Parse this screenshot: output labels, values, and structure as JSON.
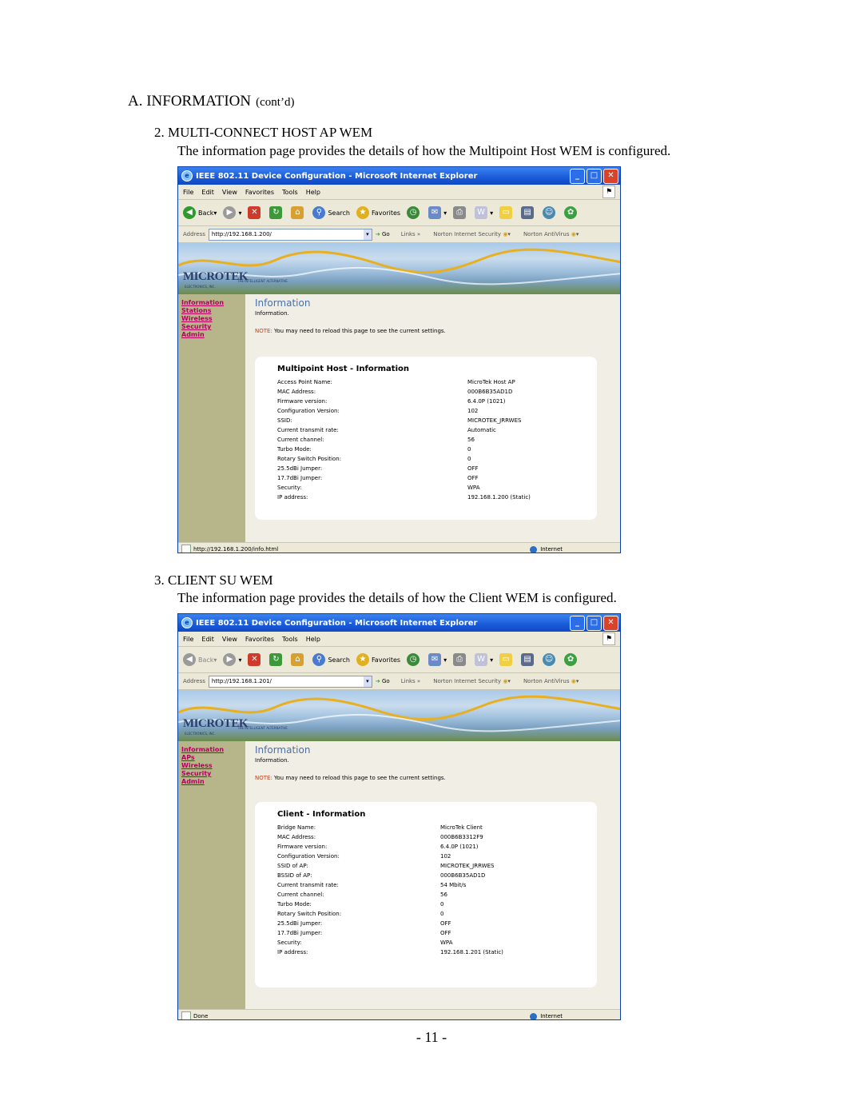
{
  "heading": {
    "main": "A. INFORMATION",
    "contd": "(cont’d)"
  },
  "sections": [
    {
      "title": "2.  MULTI-CONNECT HOST AP WEM",
      "description": "The information page provides the details of how the Multipoint Host WEM is configured.",
      "browser": {
        "window_title": "IEEE 802.11 Device Configuration - Microsoft Internet Explorer",
        "menu": [
          "File",
          "Edit",
          "View",
          "Favorites",
          "Tools",
          "Help"
        ],
        "toolbar": {
          "back": "Back",
          "search": "Search",
          "favorites": "Favorites"
        },
        "address_label": "Address",
        "address": "http://192.168.1.200/",
        "go": "Go",
        "links": "Links",
        "norton_security": "Norton Internet Security",
        "norton_antivirus": "Norton AntiVirus",
        "logo": "MICROTEK",
        "logo_sub": "ELECTRONICS, INC.",
        "logo_tag": "THE INTELLIGENT ALTERNATIVE",
        "nav": [
          "Information",
          "Stations",
          "Wireless",
          "Security",
          "Admin"
        ],
        "page_title": "Information",
        "page_subtitle": "Information.",
        "note_label": "NOTE:",
        "note_text": "You may need to reload this page to see the current settings.",
        "card_title": "Multipoint Host - Information",
        "rows": [
          {
            "label": "Access Point Name:",
            "value": "MicroTek Host AP"
          },
          {
            "label": "MAC Address:",
            "value": "000B6B35AD1D"
          },
          {
            "label": "Firmware version:",
            "value": "6.4.0P (1021)"
          },
          {
            "label": "Configuration Version:",
            "value": "102"
          },
          {
            "label": "SSID:",
            "value": "MICROTEK_JRRWES"
          },
          {
            "label": "Current transmit rate:",
            "value": "Automatic"
          },
          {
            "label": "Current channel:",
            "value": "56"
          },
          {
            "label": "Turbo Mode:",
            "value": "0"
          },
          {
            "label": "Rotary Switch Position:",
            "value": "0"
          },
          {
            "label": "25.5dBi Jumper:",
            "value": "OFF"
          },
          {
            "label": "17.7dBi Jumper:",
            "value": "OFF"
          },
          {
            "label": "Security:",
            "value": "WPA"
          },
          {
            "label": "IP address:",
            "value": "192.168.1.200 (Static)"
          }
        ],
        "status_text": "http://192.168.1.200/info.html",
        "status_zone": "Internet"
      }
    },
    {
      "title": "3.  CLIENT SU WEM",
      "description": "The information page provides the details of how the Client WEM is configured.",
      "browser": {
        "window_title": "IEEE 802.11 Device Configuration - Microsoft Internet Explorer",
        "menu": [
          "File",
          "Edit",
          "View",
          "Favorites",
          "Tools",
          "Help"
        ],
        "toolbar": {
          "back": "Back",
          "search": "Search",
          "favorites": "Favorites"
        },
        "address_label": "Address",
        "address": "http://192.168.1.201/",
        "go": "Go",
        "links": "Links",
        "norton_security": "Norton Internet Security",
        "norton_antivirus": "Norton AntiVirus",
        "logo": "MICROTEK",
        "logo_sub": "ELECTRONICS, INC.",
        "logo_tag": "THE INTELLIGENT ALTERNATIVE",
        "nav": [
          "Information",
          "APs",
          "Wireless",
          "Security",
          "Admin"
        ],
        "page_title": "Information",
        "page_subtitle": "Information.",
        "note_label": "NOTE:",
        "note_text": "You may need to reload this page to see the current settings.",
        "card_title": "Client - Information",
        "rows": [
          {
            "label": "Bridge Name:",
            "value": "MicroTek Client"
          },
          {
            "label": "MAC Address:",
            "value": "000B6B3312F9"
          },
          {
            "label": "Firmware version:",
            "value": "6.4.0P (1021)"
          },
          {
            "label": "Configuration Version:",
            "value": "102"
          },
          {
            "label": "SSID of AP:",
            "value": "MICROTEK_JRRWES"
          },
          {
            "label": "BSSID of AP:",
            "value": "000B6B35AD1D"
          },
          {
            "label": "Current transmit rate:",
            "value": "54 Mbit/s"
          },
          {
            "label": "Current channel:",
            "value": "56"
          },
          {
            "label": "Turbo Mode:",
            "value": "0"
          },
          {
            "label": "Rotary Switch Position:",
            "value": "0"
          },
          {
            "label": "25.5dBi Jumper:",
            "value": "OFF"
          },
          {
            "label": "17.7dBi Jumper:",
            "value": "OFF"
          },
          {
            "label": "Security:",
            "value": "WPA"
          },
          {
            "label": "IP address:",
            "value": "192.168.1.201 (Static)"
          }
        ],
        "status_text": "Done",
        "status_zone": "Internet"
      }
    }
  ],
  "page_number": "- 11 -"
}
